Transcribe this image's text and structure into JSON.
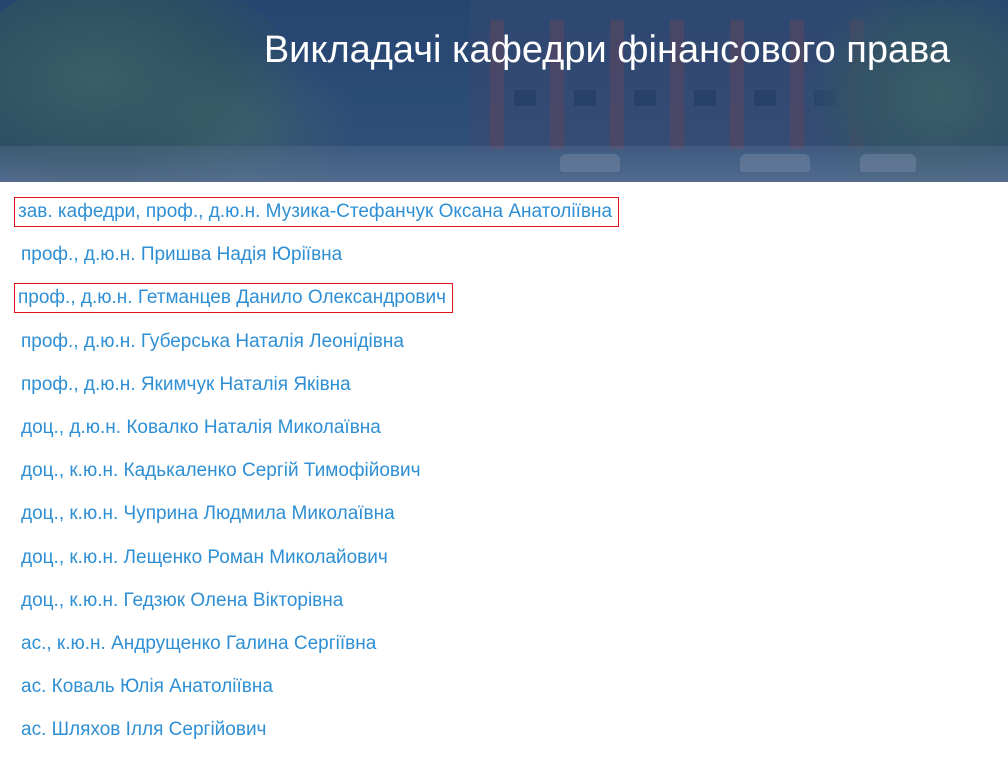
{
  "header": {
    "title": "Викладачі кафедри фінансового права"
  },
  "faculty": [
    {
      "label": "зав. кафедри, проф., д.ю.н. Музика-Стефанчук Оксана Анатоліївна",
      "highlighted": true
    },
    {
      "label": "проф., д.ю.н. Пришва Надія Юріївна",
      "highlighted": false
    },
    {
      "label": "проф., д.ю.н. Гетманцев Данило Олександрович",
      "highlighted": true
    },
    {
      "label": "проф., д.ю.н. Губерська Наталія Леонідівна",
      "highlighted": false
    },
    {
      "label": "проф., д.ю.н. Якимчук Наталія Яківна",
      "highlighted": false
    },
    {
      "label": "доц., д.ю.н. Ковалко Наталія Миколаївна",
      "highlighted": false
    },
    {
      "label": "доц., к.ю.н. Кадькаленко Сергій Тимофійович",
      "highlighted": false
    },
    {
      "label": "доц., к.ю.н. Чуприна Людмила Миколаївна",
      "highlighted": false
    },
    {
      "label": "доц., к.ю.н. Лещенко Роман Миколайович",
      "highlighted": false
    },
    {
      "label": "доц., к.ю.н. Гедзюк Олена Вікторівна",
      "highlighted": false
    },
    {
      "label": "ас., к.ю.н. Андрущенко Галина Сергіївна",
      "highlighted": false
    },
    {
      "label": "ас. Коваль Юлія Анатоліївна",
      "highlighted": false
    },
    {
      "label": "ас. Шляхов Ілля Сергійович",
      "highlighted": false
    }
  ],
  "colors": {
    "link": "#2e8fd4",
    "highlight_box": "#e0151c",
    "hero_overlay": "#2c4a72"
  }
}
